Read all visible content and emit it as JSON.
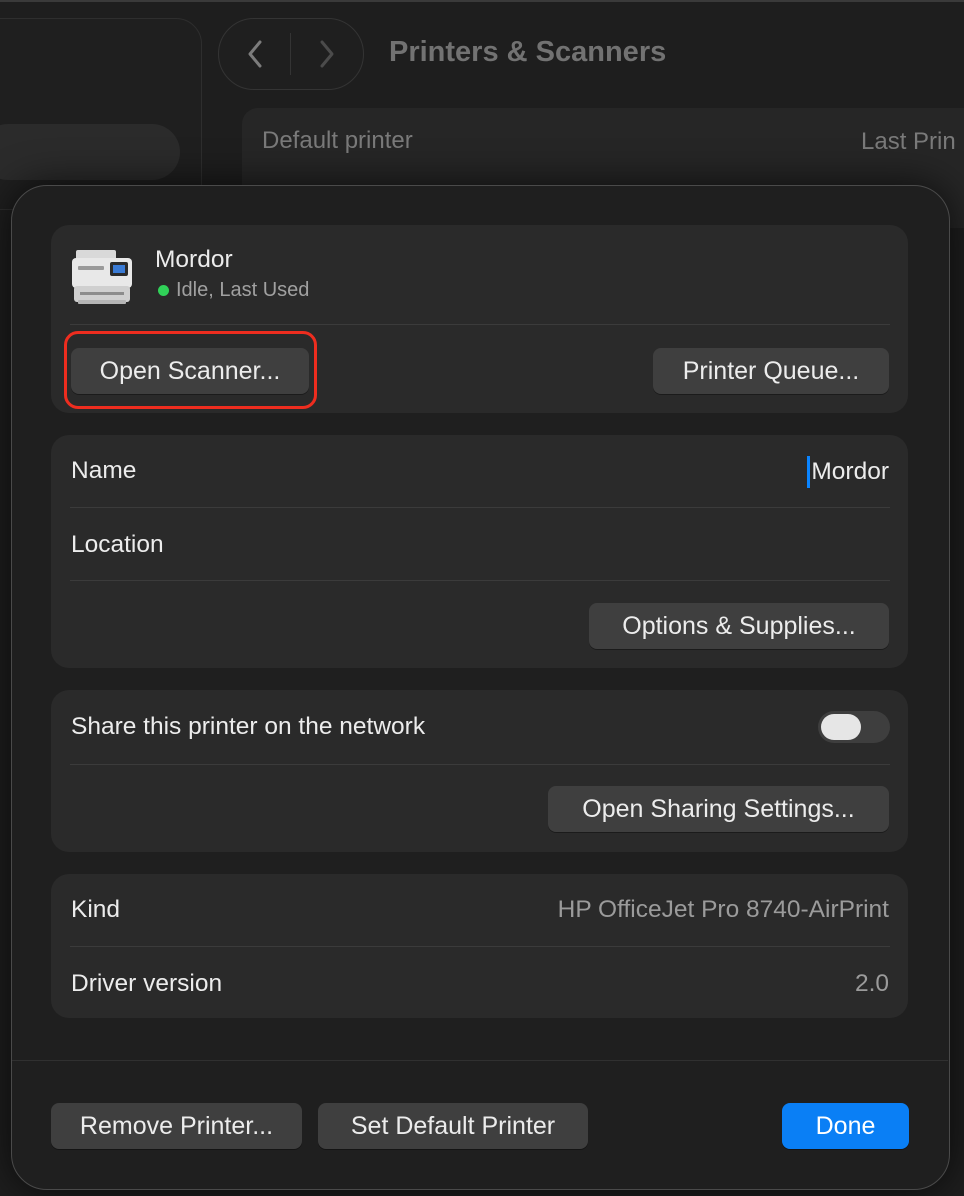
{
  "window": {
    "title": "Printers & Scanners",
    "header_labels": {
      "default_printer": "Default printer",
      "last_printer_fragment": "Last Prin"
    }
  },
  "printer": {
    "name": "Mordor",
    "status": "Idle, Last Used",
    "status_color": "#30d158",
    "open_scanner_label": "Open Scanner...",
    "printer_queue_label": "Printer Queue..."
  },
  "details": {
    "name_label": "Name",
    "name_value": "Mordor",
    "location_label": "Location",
    "location_value": "",
    "options_supplies_label": "Options & Supplies..."
  },
  "sharing": {
    "share_label": "Share this printer on the network",
    "share_enabled": false,
    "open_sharing_label": "Open Sharing Settings..."
  },
  "info": {
    "kind_label": "Kind",
    "kind_value": "HP OfficeJet Pro 8740-AirPrint",
    "driver_label": "Driver version",
    "driver_value": "2.0"
  },
  "footer": {
    "remove_label": "Remove Printer...",
    "set_default_label": "Set Default Printer",
    "done_label": "Done"
  },
  "colors": {
    "accent": "#0a7ff5",
    "highlight": "#ee2d1f"
  }
}
